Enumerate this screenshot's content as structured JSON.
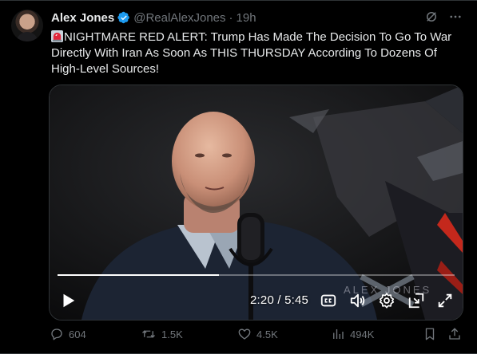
{
  "tweet": {
    "author_name": "Alex Jones",
    "handle": "@RealAlexJones",
    "separator": "·",
    "time": "19h",
    "text": "NIGHTMARE RED ALERT: Trump Has Made The Decision To Go To War Directly With Iran As Soon As THIS THURSDAY According To Dozens Of High-Level Sources!"
  },
  "video": {
    "current_time": "2:20",
    "duration": "5:45",
    "time_display": "2:20 / 5:45",
    "progress_fraction": 0.406,
    "watermark": "ALEX JONES"
  },
  "actions": {
    "replies": "604",
    "reposts": "1.5K",
    "likes": "4.5K",
    "views": "494K"
  },
  "icons": [
    "verified-badge-icon",
    "grok-icon",
    "more-icon",
    "siren-emoji-icon",
    "play-icon",
    "captions-icon",
    "volume-icon",
    "settings-icon",
    "pip-icon",
    "fullscreen-icon",
    "reply-icon",
    "repost-icon",
    "like-icon",
    "views-icon",
    "bookmark-icon",
    "share-icon"
  ],
  "colors": {
    "background": "#000000",
    "text_primary": "#e7e9ea",
    "text_secondary": "#71767b",
    "verified_blue": "#1d9bf0",
    "siren_red": "#e0263a"
  }
}
